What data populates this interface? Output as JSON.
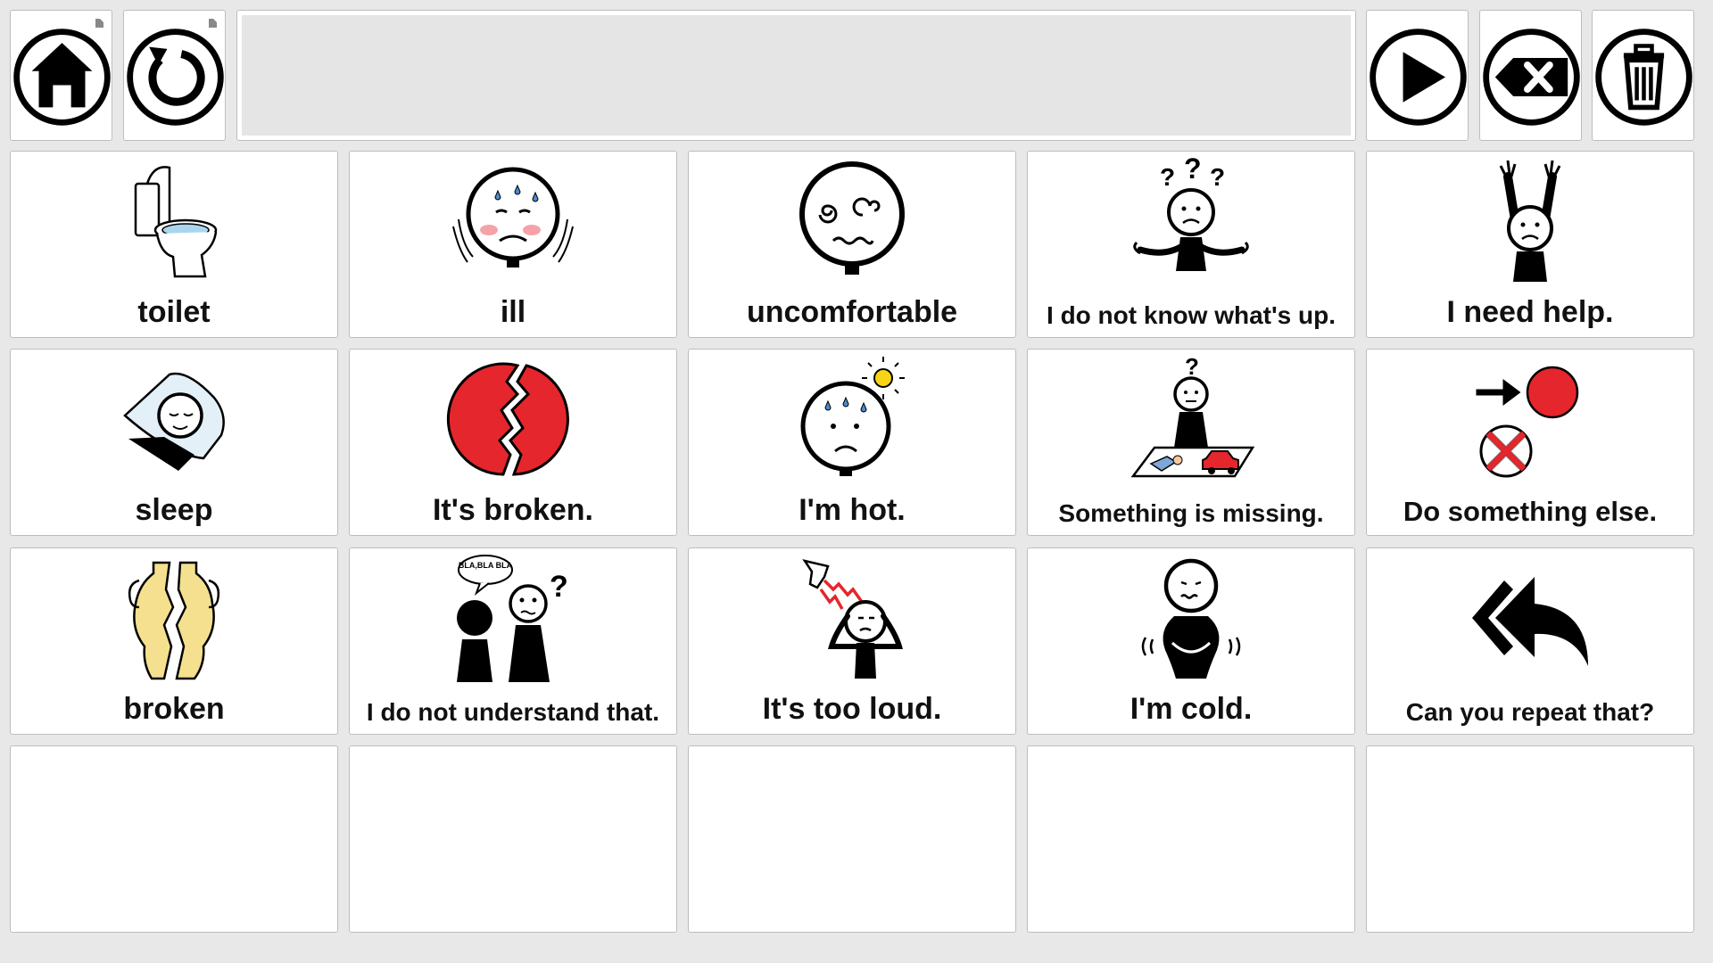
{
  "toolbar": {
    "home_icon": "home-icon",
    "back_icon": "undo-icon",
    "speak_icon": "play-icon",
    "backspace_icon": "backspace-icon",
    "clear_icon": "trash-icon",
    "message_text": ""
  },
  "grid": {
    "cells": [
      {
        "label": "toilet",
        "icon": "toilet-icon"
      },
      {
        "label": "ill",
        "icon": "sick-face-icon"
      },
      {
        "label": "uncomfortable",
        "icon": "dizzy-face-icon"
      },
      {
        "label": "I do not know what's up.",
        "icon": "confused-person-icon"
      },
      {
        "label": "I need help.",
        "icon": "help-person-icon"
      },
      {
        "label": "sleep",
        "icon": "sleeping-person-icon"
      },
      {
        "label": "It's broken.",
        "icon": "broken-circle-icon"
      },
      {
        "label": "I'm hot.",
        "icon": "hot-face-icon"
      },
      {
        "label": "Something is missing.",
        "icon": "missing-item-icon"
      },
      {
        "label": "Do something else.",
        "icon": "switch-activity-icon"
      },
      {
        "label": "broken",
        "icon": "broken-vase-icon"
      },
      {
        "label": "I do not understand that.",
        "icon": "not-understand-icon"
      },
      {
        "label": "It's too loud.",
        "icon": "loud-noise-icon"
      },
      {
        "label": "I'm cold.",
        "icon": "cold-person-icon"
      },
      {
        "label": "Can you repeat that?",
        "icon": "repeat-arrow-icon"
      }
    ],
    "bubble_text": "BLA,BLA BLA"
  },
  "colors": {
    "accent_red": "#e5262d",
    "background": "#e8e8e8"
  }
}
